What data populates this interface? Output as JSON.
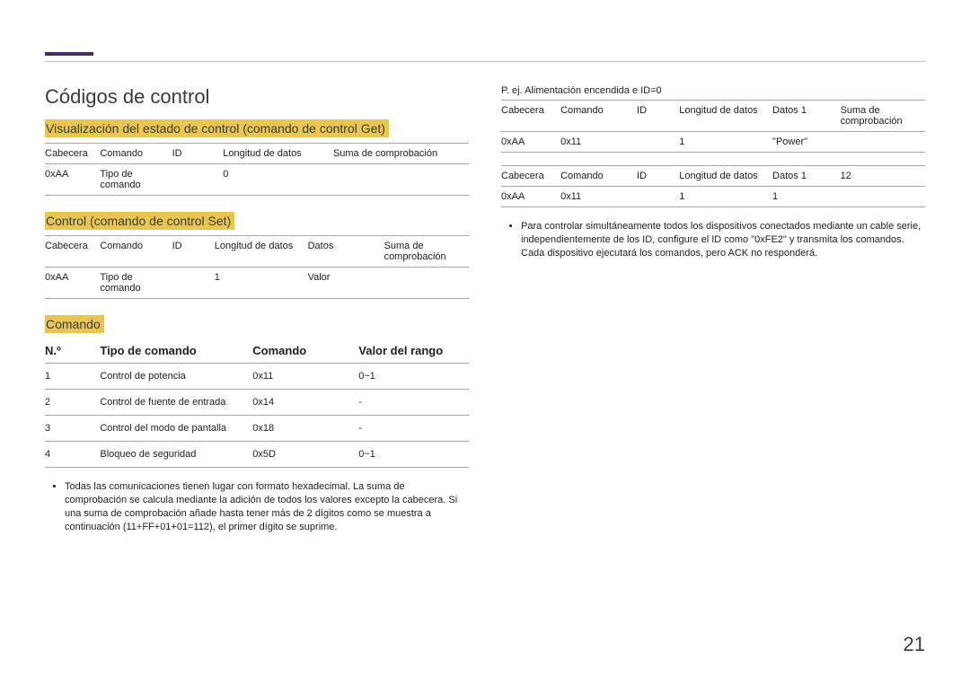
{
  "page_number": "21",
  "title": "Códigos de control",
  "left": {
    "section1": {
      "heading": "Visualización del estado de control (comando de control Get)",
      "headers": [
        "Cabecera",
        "Comando",
        "ID",
        "Longitud de datos",
        "Suma de comprobación"
      ],
      "row": [
        "0xAA",
        "Tipo de comando",
        "",
        "0",
        ""
      ]
    },
    "section2": {
      "heading": "Control (comando de control Set)",
      "headers": [
        "Cabecera",
        "Comando",
        "ID",
        "Longitud de datos",
        "Datos",
        "Suma de comprobación"
      ],
      "row": [
        "0xAA",
        "Tipo de comando",
        "",
        "1",
        "Valor",
        ""
      ]
    },
    "section3": {
      "heading": "Comando",
      "headers": [
        "N.º",
        "Tipo de comando",
        "Comando",
        "Valor del rango"
      ],
      "rows": [
        [
          "1",
          "Control de potencia",
          "0x11",
          "0~1"
        ],
        [
          "2",
          "Control de fuente de entrada",
          "0x14",
          "-"
        ],
        [
          "3",
          "Control del modo de pantalla",
          "0x18",
          "-"
        ],
        [
          "4",
          "Bloqueo de seguridad",
          "0x5D",
          "0~1"
        ]
      ]
    },
    "note": "Todas las comunicaciones tienen lugar con formato hexadecimal. La suma de comprobación se calcula mediante la adición de todos los valores excepto la cabecera. Si una suma de comprobación añade hasta tener más de 2 dígitos como se muestra a continuación (11+FF+01+01=112), el primer dígito se suprime."
  },
  "right": {
    "example_label": "P. ej. Alimentación encendida e ID=0",
    "table1": {
      "headers": [
        "Cabecera",
        "Comando",
        "ID",
        "Longitud de datos",
        "Datos 1",
        "Suma de comprobación"
      ],
      "row": [
        "0xAA",
        "0x11",
        "",
        "1",
        "\"Power\"",
        ""
      ]
    },
    "table2": {
      "headers": [
        "Cabecera",
        "Comando",
        "ID",
        "Longitud de datos",
        "Datos 1",
        "12"
      ],
      "row": [
        "0xAA",
        "0x11",
        "",
        "1",
        "1",
        ""
      ]
    },
    "note": "Para controlar simultáneamente todos los dispositivos conectados mediante un cable serie, independientemente de los ID, configure el ID como \"0xFE2\" y transmita los comandos. Cada dispositivo ejecutará los comandos, pero ACK no responderá."
  }
}
